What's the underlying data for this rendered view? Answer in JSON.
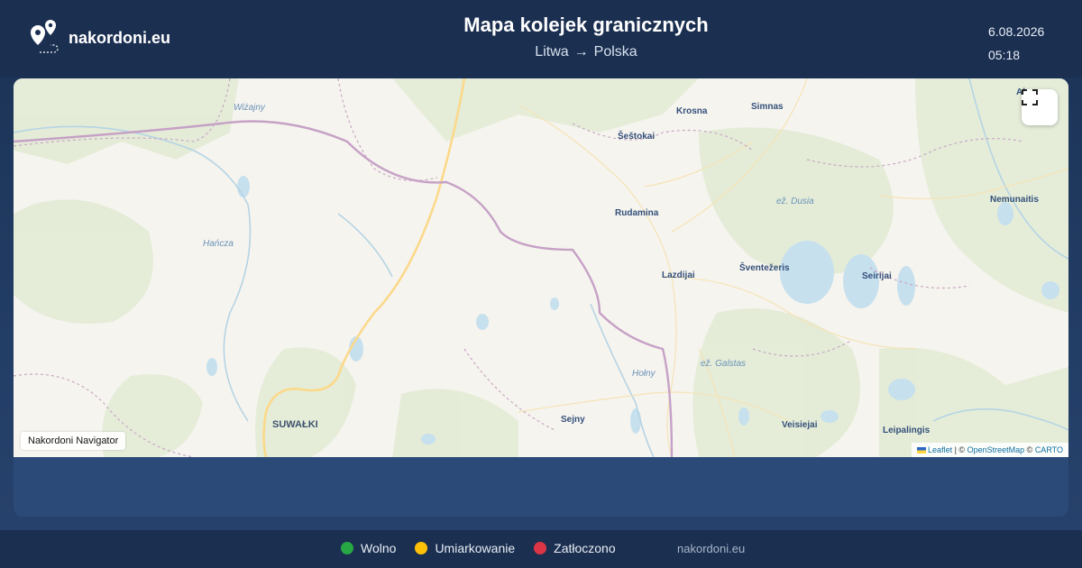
{
  "header": {
    "brand": "nakordoni.eu",
    "title": "Mapa kolejek granicznych",
    "route_from": "Litwa",
    "route_arrow": "→",
    "route_to": "Polska",
    "date": "6.08.2026",
    "time": "05:18"
  },
  "map": {
    "places": {
      "krosna": "Krosna",
      "simnas": "Simnas",
      "sestokai": "Šeštokai",
      "rudamina": "Rudamina",
      "nemunaitis": "Nemunaitis",
      "lazdijai": "Lazdijai",
      "sventezeris": "Šventežeris",
      "seirijai": "Seirijai",
      "sejny": "Sejny",
      "veisiejai": "Veisiejai",
      "suwalki": "SUWAŁKI",
      "leipalingis": "Leipalingis",
      "alytus_partial": "Al"
    },
    "water": {
      "wizajny": "Wiżajny",
      "hancza": "Hańcza",
      "dusia": "ež. Dusia",
      "galstas": "ež. Galstas",
      "hony": "Hołny"
    },
    "fullscreen_icon": "expand-icon",
    "navigator_label": "Nakordoni Navigator",
    "attribution": {
      "leaflet": "Leaflet",
      "sep1": "| ©",
      "osm": "OpenStreetMap",
      "sep2": "©",
      "carto": "CARTO"
    }
  },
  "legend": [
    {
      "label": "Wolno",
      "color": "#28a745"
    },
    {
      "label": "Umiarkowanie",
      "color": "#ffc107"
    },
    {
      "label": "Zatłoczono",
      "color": "#dc3545"
    }
  ],
  "footer": {
    "site": "nakordoni.eu"
  }
}
